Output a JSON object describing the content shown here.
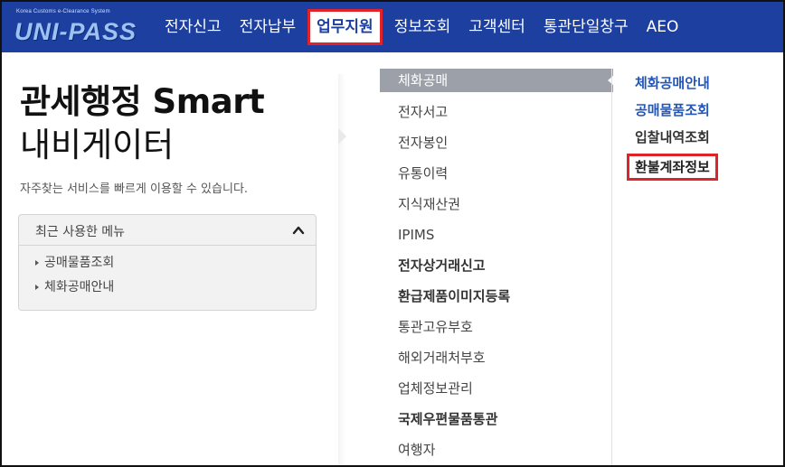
{
  "header": {
    "logo_small": "Korea Customs e-Clearance System",
    "logo_main": "UNI-PASS",
    "nav": [
      {
        "label": "전자신고",
        "active": false
      },
      {
        "label": "전자납부",
        "active": false
      },
      {
        "label": "업무지원",
        "active": true
      },
      {
        "label": "정보조회",
        "active": false
      },
      {
        "label": "고객센터",
        "active": false
      },
      {
        "label": "통관단일창구",
        "active": false
      },
      {
        "label": "AEO",
        "active": false
      }
    ]
  },
  "left": {
    "title_line1": "관세행정 Smart",
    "title_line2": "내비게이터",
    "subtitle": "자주찾는 서비스를 빠르게 이용할 수 있습니다.",
    "recent": {
      "title": "최근 사용한 메뉴",
      "items": [
        "공매물품조회",
        "체화공매안내"
      ]
    }
  },
  "middle_menu": [
    {
      "label": "체화공매",
      "selected": true,
      "bold": false
    },
    {
      "label": "전자서고",
      "selected": false,
      "bold": false
    },
    {
      "label": "전자봉인",
      "selected": false,
      "bold": false
    },
    {
      "label": "유통이력",
      "selected": false,
      "bold": false
    },
    {
      "label": "지식재산권",
      "selected": false,
      "bold": false
    },
    {
      "label": "IPIMS",
      "selected": false,
      "bold": false
    },
    {
      "label": "전자상거래신고",
      "selected": false,
      "bold": true
    },
    {
      "label": "환급제품이미지등록",
      "selected": false,
      "bold": true
    },
    {
      "label": "통관고유부호",
      "selected": false,
      "bold": false
    },
    {
      "label": "해외거래처부호",
      "selected": false,
      "bold": false
    },
    {
      "label": "업체정보관리",
      "selected": false,
      "bold": false
    },
    {
      "label": "국제우편물품통관",
      "selected": false,
      "bold": true
    },
    {
      "label": "여행자",
      "selected": false,
      "bold": false
    }
  ],
  "sub_menu": [
    {
      "label": "체화공매안내",
      "style": "blue"
    },
    {
      "label": "공매물품조회",
      "style": "blue"
    },
    {
      "label": "입찰내역조회",
      "style": "dark"
    },
    {
      "label": "환불계좌정보",
      "style": "boxed"
    }
  ],
  "colors": {
    "header_bg": "#1d3fa0",
    "highlight_border": "#e0222a",
    "selected_bg": "#9ca0a8",
    "link_blue": "#2456b8"
  }
}
